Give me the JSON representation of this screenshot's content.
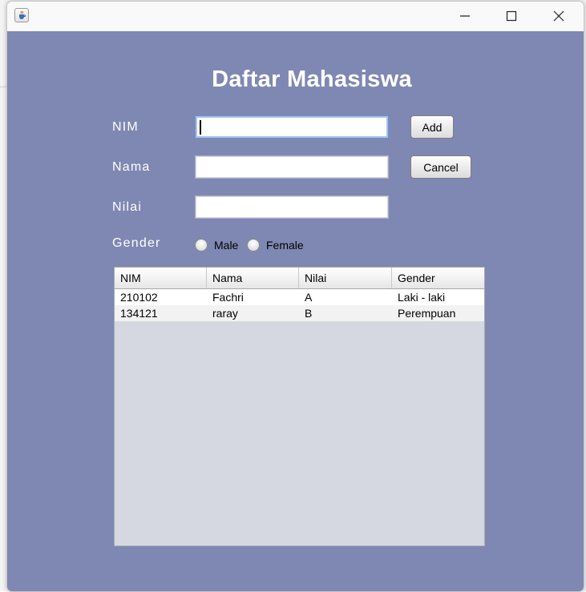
{
  "window": {
    "app_icon": "java-cup-icon",
    "controls": [
      "minimize-icon",
      "maximize-icon",
      "close-icon"
    ]
  },
  "form": {
    "title": "Daftar Mahasiswa",
    "nim_label": "NIM",
    "nama_label": "Nama",
    "nilai_label": "Nilai",
    "gender_label": "Gender",
    "nim_value": "",
    "nama_value": "",
    "nilai_value": "",
    "add_label": "Add",
    "cancel_label": "Cancel",
    "gender_options": [
      "Male",
      "Female"
    ],
    "gender_selected": null
  },
  "table": {
    "columns": [
      "NIM",
      "Nama",
      "Nilai",
      "Gender"
    ],
    "rows": [
      [
        "210102",
        "Fachri",
        "A",
        "Laki - laki"
      ],
      [
        "134121",
        "raray",
        "B",
        "Perempuan"
      ]
    ]
  },
  "colors": {
    "panel_background": "#7f88b2",
    "table_viewport": "#d5d8e0"
  }
}
